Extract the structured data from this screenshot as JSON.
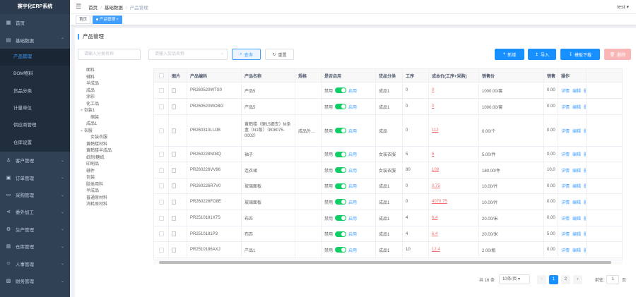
{
  "app": {
    "title": "赛宇化ERP系统",
    "user": "test"
  },
  "sidebar": {
    "items": [
      {
        "label": "首页",
        "icon": "dashboard-icon"
      },
      {
        "label": "基础数据",
        "icon": "document-icon",
        "expanded": true,
        "children": [
          "产品管理",
          "BOM物料",
          "货品分类",
          "计量单位",
          "供应商管理",
          "仓库设置"
        ]
      },
      {
        "label": "客户管理",
        "icon": "user-icon"
      },
      {
        "label": "订单管理",
        "icon": "order-icon"
      },
      {
        "label": "采购管理",
        "icon": "monitor-icon"
      },
      {
        "label": "委外加工",
        "icon": "share-icon"
      },
      {
        "label": "生产管理",
        "icon": "production-icon"
      },
      {
        "label": "仓库管理",
        "icon": "warehouse-icon"
      },
      {
        "label": "人事管理",
        "icon": "person-icon"
      },
      {
        "label": "财务管理",
        "icon": "finance-icon"
      }
    ]
  },
  "breadcrumb": [
    "首页",
    "基础数据",
    "产品管理"
  ],
  "tags": [
    "首页",
    "产品管理"
  ],
  "page": {
    "title": "产品管理"
  },
  "search": {
    "category_placeholder": "请输入分类名称",
    "product_placeholder": "请输入货品名称",
    "query_label": "查询",
    "reset_label": "重置"
  },
  "toolbar": {
    "add": "新增",
    "import": "导入",
    "template": "模板下载",
    "delete": "删除"
  },
  "tree": [
    "面料",
    "辅料",
    "半成品",
    "成品",
    "涂彩",
    "化工品",
    "包装1",
    "缩装",
    "成品1",
    "衣服",
    "女装衣服",
    "黄鹤楼材料",
    "黄鹤楼半成品",
    "纸制/糖纸",
    "印刷品",
    "辅件",
    "包装",
    "胶类用料",
    "半成品",
    "普通原材料",
    "消耗原材料"
  ],
  "table": {
    "columns": [
      "图片",
      "产品编码",
      "产品名称",
      "规格",
      "是否启用",
      "货品分类",
      "工序",
      "成本价(工序+采购)",
      "销售价",
      "销售",
      "操作"
    ],
    "rows": [
      {
        "code": "PR260520WTS0",
        "name": "产品5",
        "spec": "",
        "off": "禁用",
        "on": "启用",
        "cat": "成品1",
        "proc": "0",
        "cost": "0",
        "price": "1000.00/套",
        "sales": "0.00"
      },
      {
        "code": "PR260520WOBG",
        "name": "产品5",
        "spec": "",
        "off": "禁用",
        "on": "启用",
        "cat": "成品1",
        "proc": "0",
        "cost": "0",
        "price": "1000.00/套",
        "sales": "0.00"
      },
      {
        "code": "PR260310LUJB",
        "name": "黄鹤楼（硬15细支）M条盒（N1版）（808075-0002）",
        "spec": "成品外…",
        "off": "禁用",
        "on": "启用",
        "cat": "成品",
        "proc": "0",
        "cost": "112",
        "price": "0.00/个",
        "sales": "0.00"
      },
      {
        "code": "PR260228N08Q",
        "name": "袖子",
        "spec": "",
        "off": "禁用",
        "on": "启用",
        "cat": "女装衣服",
        "proc": "5",
        "cost": "6",
        "price": "5.00/件",
        "sales": "0.00"
      },
      {
        "code": "PR260226VV96",
        "name": "连衣裙",
        "spec": "",
        "off": "禁用",
        "on": "启用",
        "cat": "女装衣服",
        "proc": "80",
        "cost": "109",
        "price": "180.00/件",
        "sales": "10.0"
      },
      {
        "code": "PR260226R7V0",
        "name": "玻璃面板",
        "spec": "",
        "off": "禁用",
        "on": "启用",
        "cat": "成品1",
        "proc": "0",
        "cost": "0.75",
        "price": "10.00/片",
        "sales": "0.00"
      },
      {
        "code": "PR260226FO8E",
        "name": "玻璃面板",
        "spec": "",
        "off": "禁用",
        "on": "启用",
        "cat": "成品1",
        "proc": "0",
        "cost": "4070.75",
        "price": "10.00/片",
        "sales": "0.00"
      },
      {
        "code": "PR2510181X7S",
        "name": "布匹",
        "spec": "",
        "off": "禁用",
        "on": "启用",
        "cat": "成品1",
        "proc": "4",
        "cost": "6.4",
        "price": "20.00/米",
        "sales": "0.00"
      },
      {
        "code": "PR2510181P3",
        "name": "布匹",
        "spec": "",
        "off": "禁用",
        "on": "启用",
        "cat": "成品1",
        "proc": "4",
        "cost": "6.4",
        "price": "20.00/米",
        "sales": "5.00"
      },
      {
        "code": "PR2510186AXJ",
        "name": "产品1",
        "spec": "",
        "off": "禁用",
        "on": "启用",
        "cat": "成品1",
        "proc": "10",
        "cost": "12.4",
        "price": "2.00/瓶",
        "sales": "0.00"
      }
    ],
    "actions": [
      "详情",
      "编辑",
      "删除"
    ]
  },
  "pagination": {
    "total": "共 16 条",
    "page_size": "10条/页",
    "pages": [
      "1",
      "2"
    ],
    "goto_label": "前往",
    "goto_value": "1",
    "page_suffix": "页",
    "current": 1
  }
}
